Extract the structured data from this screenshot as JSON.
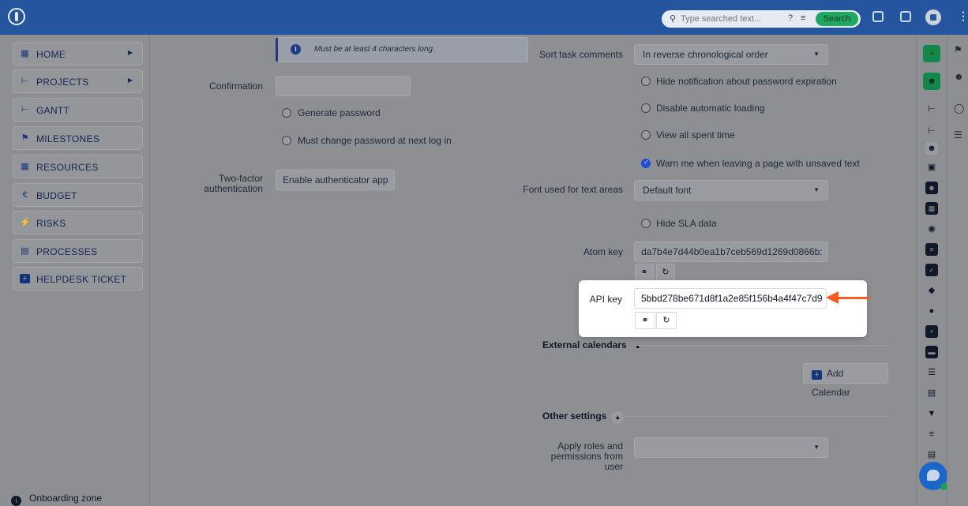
{
  "topbar": {
    "search_placeholder": "Type searched text...",
    "search_button": "Search",
    "icons": [
      "app-logo-icon",
      "search-icon",
      "help-icon",
      "filter-icon",
      "calendar-icon",
      "logout-icon",
      "user-avatar",
      "more-icon"
    ]
  },
  "sidebar": {
    "items": [
      {
        "label": "HOME",
        "icon": "home-icon",
        "has_submenu": true
      },
      {
        "label": "PROJECTS",
        "icon": "projects-icon",
        "has_submenu": true
      },
      {
        "label": "GANTT",
        "icon": "gantt-icon",
        "has_submenu": false
      },
      {
        "label": "MILESTONES",
        "icon": "flag-icon",
        "has_submenu": false
      },
      {
        "label": "RESOURCES",
        "icon": "resources-icon",
        "has_submenu": false
      },
      {
        "label": "BUDGET",
        "icon": "euro-icon",
        "has_submenu": false
      },
      {
        "label": "RISKS",
        "icon": "bolt-icon",
        "has_submenu": false
      },
      {
        "label": "PROCESSES",
        "icon": "processes-icon",
        "has_submenu": false
      },
      {
        "label": "HELPDESK TICKET",
        "icon": "plus-box-icon",
        "has_submenu": false
      }
    ],
    "onboarding": "Onboarding zone"
  },
  "left_form": {
    "password_hint": "Must be at least 4 characters long.",
    "confirmation_label": "Confirmation",
    "confirmation_value": "",
    "generate_password": "Generate password",
    "must_change": "Must change password at next log in",
    "two_factor_label": "Two-factor authentication",
    "enable_authenticator": "Enable authenticator app"
  },
  "right_form": {
    "sort_comments_label": "Sort task comments",
    "sort_comments_value": "In reverse chronological order",
    "hide_password_notif": "Hide notification about password expiration",
    "disable_autoload": "Disable automatic loading",
    "view_spent_time": "View all spent time",
    "warn_unsaved": "Warn me when leaving a page with unsaved text",
    "warn_unsaved_checked": true,
    "font_label": "Font used for text areas",
    "font_value": "Default font",
    "hide_sla": "Hide SLA data",
    "atom_key_label": "Atom key",
    "atom_key_value": "da7b4e7d44b0ea1b7ceb569d1269d0866b:",
    "api_key_label": "API key",
    "api_key_value": "5bbd278be671d8f1a2e85f156b4a4f47c7d9",
    "external_calendars": "External calendars",
    "add_calendar": "Add Calendar",
    "other_settings": "Other settings",
    "apply_roles_label": "Apply roles and permissions from user",
    "apply_roles_value": ""
  },
  "colors": {
    "topbar": "#25559f",
    "accent_green": "#1fa862",
    "highlight_arrow": "#ff5a1f"
  }
}
